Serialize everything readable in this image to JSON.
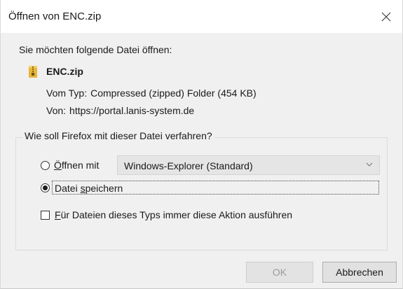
{
  "window": {
    "title": "Öffnen von ENC.zip"
  },
  "intro": "Sie möchten folgende Datei öffnen:",
  "file": {
    "icon": "zip-folder-icon",
    "name": "ENC.zip",
    "type_label": "Vom Typ:",
    "type_value": "Compressed (zipped) Folder (454 KB)",
    "from_label": "Von:",
    "from_value": "https://portal.lanis-system.de"
  },
  "action_group": {
    "legend": "Wie soll Firefox mit dieser Datei verfahren?",
    "open_with": {
      "label_mnemonic": "Ö",
      "label_rest": "ffnen mit",
      "selected": false,
      "app": "Windows-Explorer (Standard)"
    },
    "save": {
      "label_before": "Datei ",
      "label_mnemonic": "s",
      "label_after": "peichern",
      "selected": true
    },
    "always": {
      "label_mnemonic": "F",
      "label_rest": "ür Dateien dieses Typs immer diese Aktion ausführen",
      "checked": false
    }
  },
  "buttons": {
    "ok": "OK",
    "cancel": "Abbrechen"
  },
  "colors": {
    "dialog_bg": "#f0f0f0",
    "titlebar_bg": "#ffffff",
    "zip_icon": "#e8b53a",
    "disabled_text": "#9b9b9b"
  }
}
